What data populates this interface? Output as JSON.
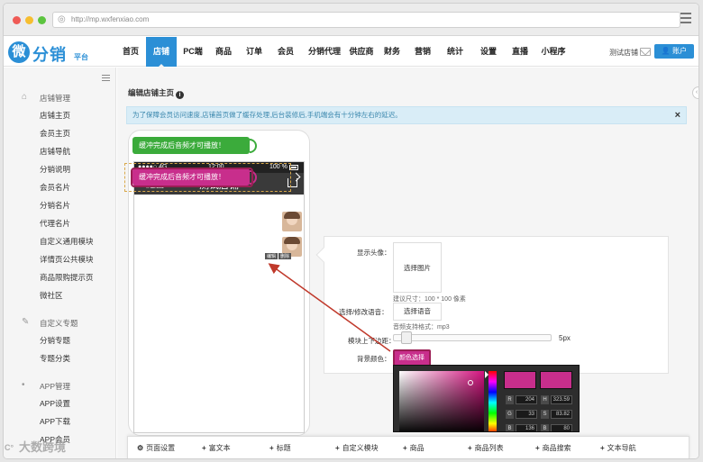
{
  "browser": {
    "url": "http://mp.wxfenxiao.com"
  },
  "brand": {
    "logo_char": "微",
    "logo_text": "分销",
    "logo_sub": "平台"
  },
  "topnav": {
    "items": [
      "首页",
      "店铺",
      "PC端",
      "商品",
      "订单",
      "会员",
      "分销代理",
      "供应商",
      "财务",
      "营销",
      "统计",
      "设置",
      "直播",
      "小程序"
    ],
    "active": "店铺",
    "shop_name": "测试店铺",
    "account_label": "账户"
  },
  "sidebar": {
    "sections": [
      {
        "title": "店铺管理",
        "icon": "home-icon",
        "items": [
          "店铺主页",
          "会员主页",
          "店铺导航",
          "分销说明",
          "会员名片",
          "分销名片",
          "代理名片",
          "自定义通用模块",
          "详情页公共模块",
          "商品限购提示页",
          "微社区"
        ]
      },
      {
        "title": "自定义专题",
        "icon": "pencil-icon",
        "items": [
          "分销专题",
          "专题分类"
        ]
      },
      {
        "title": "APP管理",
        "icon": "apple-icon",
        "items": [
          "APP设置",
          "APP下载",
          "APP会员"
        ]
      }
    ]
  },
  "main": {
    "page_title": "编辑店铺主页",
    "notice": "为了保障会员访问速度,店铺首页做了缓存处理,后台装修后,手机端会有十分钟左右的延迟。",
    "notice_close": "×"
  },
  "phone": {
    "status_left": "●●●●○ 4G",
    "status_time": "12:00",
    "status_battery": "100 %",
    "back_label": "返回",
    "title": "测试店铺",
    "voice_bubbles": [
      {
        "text": "缓冲完成后音频才可播放！",
        "color": "#3bab3b"
      },
      {
        "text": "缓冲完成后音频才可播放！",
        "color": "#c82e8c"
      }
    ],
    "mini_tags": [
      "编辑",
      "删除"
    ]
  },
  "panel": {
    "avatar_label": "显示头像：",
    "select_image": "选择图片",
    "image_hint": "建议尺寸：100 * 100 像素",
    "voice_label": "选择/修改语音：",
    "select_voice": "选择语音",
    "voice_hint": "音频支持格式：mp3",
    "margin_label": "模块上下边距：",
    "margin_value": "5px",
    "margin_level": 0.05,
    "bg_color_label": "背景颜色：",
    "bg_color_button": "颜色选择",
    "bg_color": "#c82e8c"
  },
  "color_picker": {
    "fields": [
      {
        "label": "R",
        "value": "204"
      },
      {
        "label": "G",
        "value": "33"
      },
      {
        "label": "B",
        "value": "136"
      },
      {
        "label": "H",
        "value": "323.59"
      },
      {
        "label": "S",
        "value": "83.82"
      },
      {
        "label": "B",
        "value": "80"
      }
    ]
  },
  "toolbar": {
    "items": [
      {
        "label": "页面设置",
        "prefix": "⚙"
      },
      {
        "label": "富文本",
        "prefix": "+"
      },
      {
        "label": "标题",
        "prefix": "+"
      },
      {
        "label": "自定义模块",
        "prefix": "+"
      },
      {
        "label": "商品",
        "prefix": "+"
      },
      {
        "label": "商品列表",
        "prefix": "+"
      },
      {
        "label": "商品搜索",
        "prefix": "+"
      },
      {
        "label": "文本导航",
        "prefix": "+"
      }
    ]
  },
  "watermark": "大数跨境",
  "watermark_icon": "C°"
}
